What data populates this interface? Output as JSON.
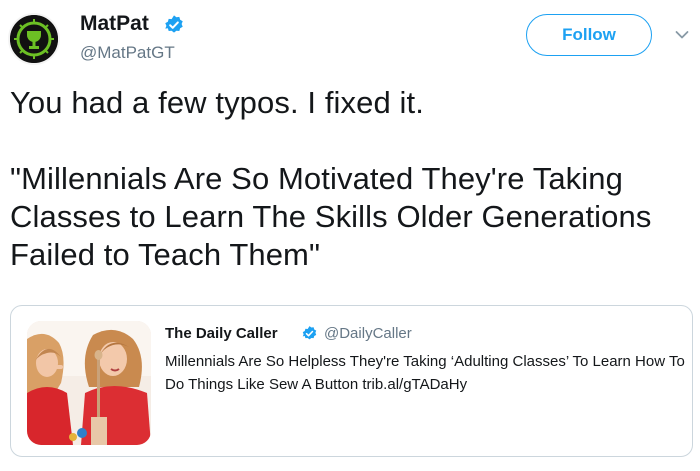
{
  "author": {
    "name": "MatPat",
    "handle": "@MatPatGT",
    "verified": true,
    "avatar_icon": "game-theory-logo"
  },
  "follow_button": {
    "label": "Follow"
  },
  "menu": {
    "icon": "chevron-down-icon"
  },
  "tweet": {
    "line1": "You had a few typos. I fixed it.",
    "line2": "\"Millennials Are So Motivated They're Taking Classes to Learn The Skills Older Generations Failed to Teach Them\""
  },
  "quoted_tweet": {
    "name": "The Daily Caller",
    "handle": "@DailyCaller",
    "verified": true,
    "text": "Millennials Are So Helpless They're Taking ‘Adulting Classes’ To Learn How To Do Things Like Sew A Button trib.al/gTADaHy"
  },
  "colors": {
    "accent": "#1da1f2",
    "text_primary": "#14171a",
    "text_secondary": "#657786",
    "border": "#ccd6dd",
    "logo_green": "#6cc024"
  }
}
